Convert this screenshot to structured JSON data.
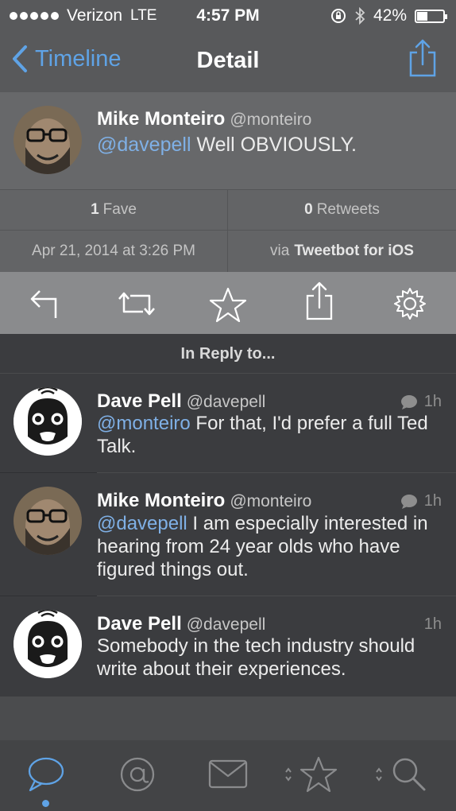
{
  "status_bar": {
    "carrier": "Verizon",
    "network": "LTE",
    "time": "4:57 PM",
    "battery": "42%",
    "battery_level": 0.42
  },
  "nav": {
    "back_label": "Timeline",
    "title": "Detail"
  },
  "main_tweet": {
    "name": "Mike Monteiro",
    "handle": "@monteiro",
    "mention": "@davepell",
    "text": " Well OBVIOUSLY.",
    "faves_count": "1",
    "faves_label": "Fave",
    "retweets_count": "0",
    "retweets_label": "Retweets",
    "date": "Apr 21, 2014 at 3:26 PM",
    "via_prefix": "via",
    "client": "Tweetbot for iOS"
  },
  "actions": [
    "reply-icon",
    "retweet-icon",
    "star-icon",
    "share-icon",
    "gear-icon"
  ],
  "reply_header": "In Reply to...",
  "replies": [
    {
      "name": "Dave Pell",
      "handle": "@davepell",
      "mention": "@monteiro",
      "text": " For that, I'd prefer a full Ted Talk.",
      "time": "1h",
      "has_conversation": true
    },
    {
      "name": "Mike Monteiro",
      "handle": "@monteiro",
      "mention": "@davepell",
      "text": " I am especially interested in hearing from 24 year olds who have figured things out.",
      "time": "1h",
      "has_conversation": true
    },
    {
      "name": "Dave Pell",
      "handle": "@davepell",
      "mention": "",
      "text": "Somebody in the tech industry should write about their experiences.",
      "time": "1h",
      "has_conversation": false
    }
  ],
  "tabs": [
    "timeline-icon",
    "mentions-icon",
    "messages-icon",
    "favorites-icon",
    "search-icon"
  ],
  "colors": {
    "accent": "#5fa3e6",
    "mention": "#7fb0e6"
  }
}
